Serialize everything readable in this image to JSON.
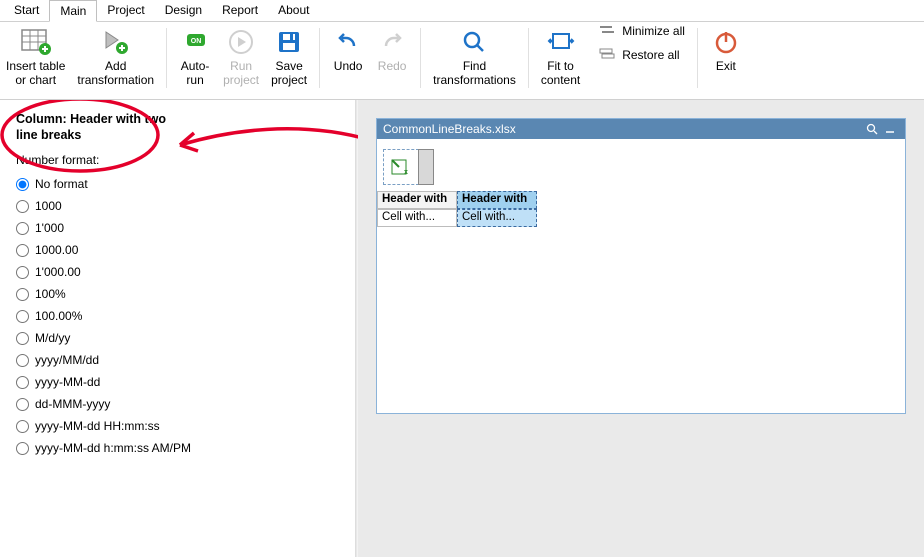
{
  "menu": {
    "items": [
      "Start",
      "Main",
      "Project",
      "Design",
      "Report",
      "About"
    ],
    "active_index": 1
  },
  "ribbon": {
    "insert_table": "Insert table\nor chart",
    "add_transform": "Add\ntransformation",
    "auto_run": "Auto-\nrun",
    "run_project": "Run\nproject",
    "save_project": "Save\nproject",
    "undo": "Undo",
    "redo": "Redo",
    "find_transform": "Find\ntransformations",
    "fit_content": "Fit to\ncontent",
    "minimize_all": "Minimize all",
    "restore_all": "Restore all",
    "exit": "Exit"
  },
  "leftpane": {
    "column_title": "Column: Header with two line breaks",
    "numfmt_label": "Number format:",
    "options": [
      "No format",
      "1000",
      "1'000",
      "1000.00",
      "1'000.00",
      "100%",
      "100.00%",
      "M/d/yy",
      "yyyy/MM/dd",
      "yyyy-MM-dd",
      "dd-MMM-yyyy",
      "yyyy-MM-dd HH:mm:ss",
      "yyyy-MM-dd h:mm:ss AM/PM"
    ],
    "selected_index": 0
  },
  "docwin": {
    "title": "CommonLineBreaks.xlsx",
    "headers": [
      "Header with",
      "Header with"
    ],
    "row1": [
      "Cell with...",
      "Cell with..."
    ],
    "selected_col": 1
  }
}
